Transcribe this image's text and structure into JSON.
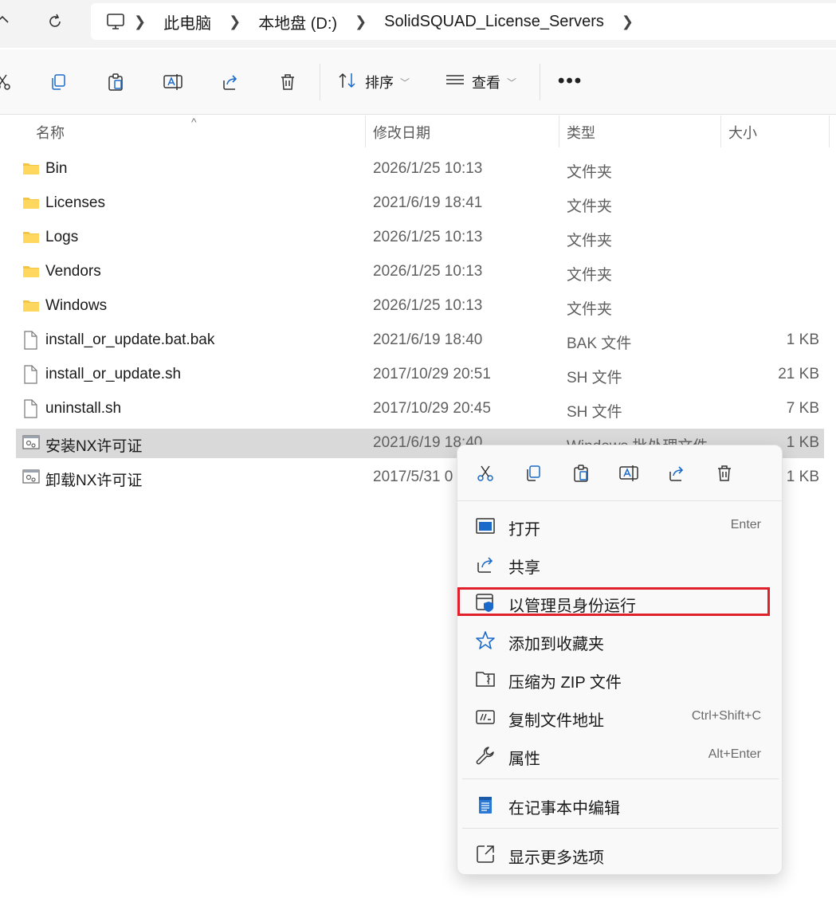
{
  "nav": {
    "refresh_icon": "refresh-icon",
    "up_icon": "up-chevron-icon"
  },
  "address": {
    "segments": [
      "此电脑",
      "本地盘 (D:)",
      "SolidSQUAD_License_Servers"
    ],
    "root_icon": "computer-icon"
  },
  "toolbar": {
    "sort_label": "排序",
    "view_label": "查看",
    "more_label": "•••"
  },
  "columns": {
    "name": "名称",
    "date": "修改日期",
    "type": "类型",
    "size": "大小"
  },
  "files": [
    {
      "name": "Bin",
      "date": "2026/1/25 10:13",
      "type": "文件夹",
      "size": "",
      "kind": "folder"
    },
    {
      "name": "Licenses",
      "date": "2021/6/19 18:41",
      "type": "文件夹",
      "size": "",
      "kind": "folder"
    },
    {
      "name": "Logs",
      "date": "2026/1/25 10:13",
      "type": "文件夹",
      "size": "",
      "kind": "folder"
    },
    {
      "name": "Vendors",
      "date": "2026/1/25 10:13",
      "type": "文件夹",
      "size": "",
      "kind": "folder"
    },
    {
      "name": "Windows",
      "date": "2026/1/25 10:13",
      "type": "文件夹",
      "size": "",
      "kind": "folder"
    },
    {
      "name": "install_or_update.bat.bak",
      "date": "2021/6/19 18:40",
      "type": "BAK 文件",
      "size": "1 KB",
      "kind": "file"
    },
    {
      "name": "install_or_update.sh",
      "date": "2017/10/29 20:51",
      "type": "SH 文件",
      "size": "21 KB",
      "kind": "file"
    },
    {
      "name": "uninstall.sh",
      "date": "2017/10/29 20:45",
      "type": "SH 文件",
      "size": "7 KB",
      "kind": "file"
    },
    {
      "name": "安装NX许可证",
      "date": "2021/6/19 18:40",
      "type": "Windows 批处理文件",
      "size": "1 KB",
      "kind": "batch"
    },
    {
      "name": "卸载NX许可证",
      "date": "2017/5/31 0",
      "type": "",
      "size": "1 KB",
      "kind": "batch"
    }
  ],
  "context_menu": {
    "items": [
      {
        "label": "打开",
        "shortcut": "Enter",
        "icon": "open-window-icon"
      },
      {
        "label": "共享",
        "shortcut": "",
        "icon": "share-icon"
      },
      {
        "label": "以管理员身份运行",
        "shortcut": "",
        "icon": "run-as-admin-shield-icon"
      },
      {
        "label": "添加到收藏夹",
        "shortcut": "",
        "icon": "star-icon"
      },
      {
        "label": "压缩为 ZIP 文件",
        "shortcut": "",
        "icon": "zip-folder-icon"
      },
      {
        "label": "复制文件地址",
        "shortcut": "Ctrl+Shift+C",
        "icon": "copy-path-icon"
      },
      {
        "label": "属性",
        "shortcut": "Alt+Enter",
        "icon": "wrench-icon"
      },
      {
        "label": "在记事本中编辑",
        "shortcut": "",
        "icon": "notepad-icon"
      },
      {
        "label": "显示更多选项",
        "shortcut": "",
        "icon": "show-more-icon"
      }
    ]
  },
  "colors": {
    "accent": "#0067c0",
    "highlight_box": "#e0202a",
    "selected_row": "#d9d9d9"
  }
}
